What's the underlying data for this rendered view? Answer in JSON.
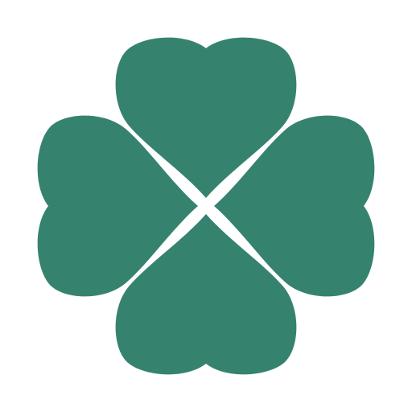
{
  "icon": {
    "name": "four-leaf-clover-icon",
    "leaf_color": "#35836F",
    "background_color": "#FFFFFF",
    "leaf_count": 4
  }
}
